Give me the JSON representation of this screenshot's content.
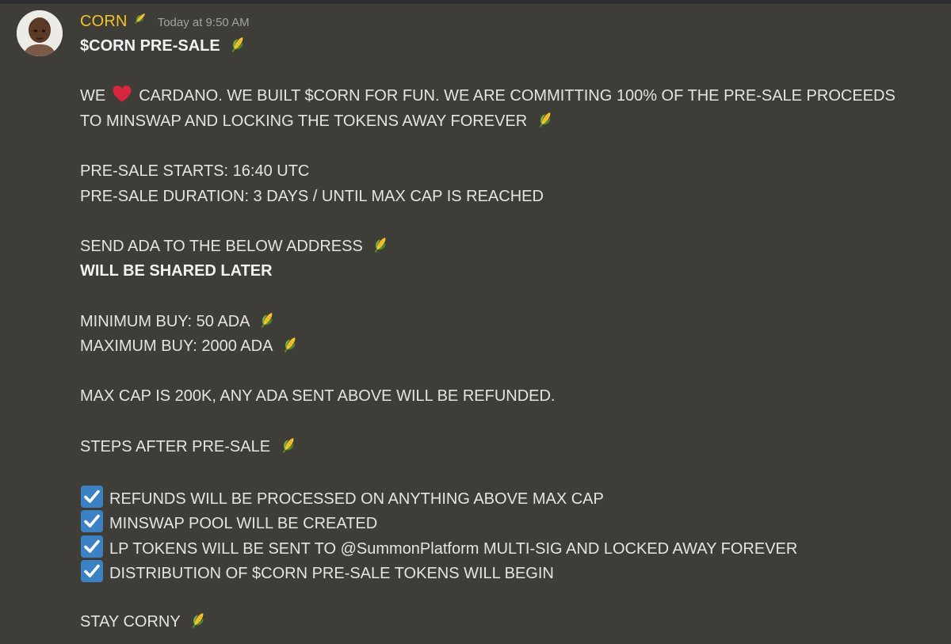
{
  "message": {
    "author": "CORN",
    "timestamp": "Today at 9:50 AM",
    "lines": {
      "title": "$CORN PRE-SALE",
      "intro_we": "WE",
      "intro_rest_1": "CARDANO. WE BUILT $CORN FOR FUN. WE ARE COMMITTING 100% OF THE PRE-SALE PROCEEDS",
      "intro_rest_2": "TO MINSWAP AND LOCKING THE TOKENS AWAY FOREVER",
      "starts": "PRE-SALE STARTS: 16:40 UTC",
      "duration": "PRE-SALE DURATION: 3 DAYS / UNTIL MAX CAP IS REACHED",
      "send": "SEND ADA TO THE BELOW ADDRESS",
      "shared_later": "WILL BE SHARED LATER",
      "min_buy": "MINIMUM BUY: 50 ADA",
      "max_buy": "MAXIMUM BUY: 2000 ADA",
      "max_cap": "MAX CAP IS 200K, ANY ADA SENT ABOVE WILL BE REFUNDED.",
      "steps": "STEPS AFTER PRE-SALE",
      "stay": "STAY CORNY"
    },
    "checklist": [
      "REFUNDS WILL BE PROCESSED ON ANYTHING ABOVE MAX CAP",
      "MINSWAP POOL WILL BE CREATED",
      "LP TOKENS WILL BE SENT TO @SummonPlatform MULTI-SIG AND LOCKED AWAY FOREVER",
      "DISTRIBUTION OF $CORN PRE-SALE TOKENS WILL BEGIN"
    ]
  },
  "icons": {
    "avatar": "user-avatar",
    "corn": "corn-icon",
    "heart": "heart-icon",
    "check": "check-box-icon"
  },
  "colors": {
    "background": "#3f3d38",
    "username": "#f0c52a",
    "timestamp": "#a3a3a3",
    "text": "#e4e4e4",
    "check_box": "#3b82c4",
    "heart": "#d7263d"
  }
}
